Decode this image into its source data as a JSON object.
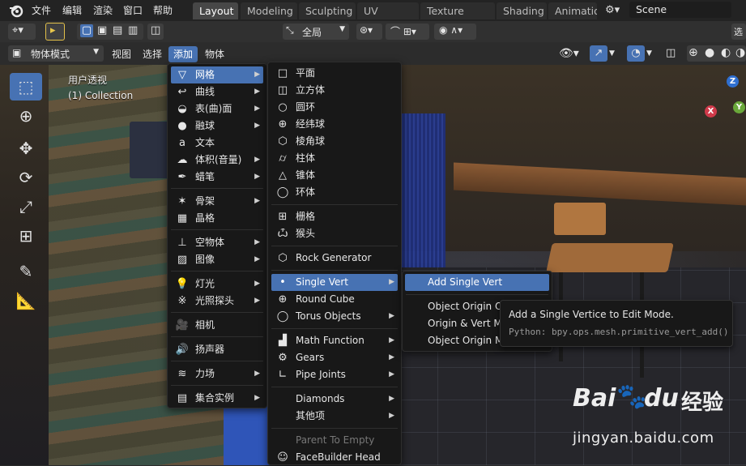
{
  "top_menu": {
    "items": [
      "文件",
      "编辑",
      "渲染",
      "窗口",
      "帮助"
    ]
  },
  "workspace_tabs": [
    "Layout",
    "Modeling",
    "Sculpting",
    "UV Editing",
    "Texture Paint",
    "Shading",
    "Animatio"
  ],
  "scene_name": "Scene",
  "tool_header": {
    "orientation": "全局"
  },
  "viewport_header": {
    "mode": "物体模式",
    "menus": [
      "视图",
      "选择",
      "添加",
      "物体"
    ]
  },
  "viewport_overlay": {
    "view_name": "用户透视",
    "collection": "(1) Collection"
  },
  "gizmo": {
    "z": "Z",
    "x": "X",
    "y": "Y"
  },
  "add_menu": {
    "items": [
      "网格",
      "曲线",
      "表(曲)面",
      "融球",
      "文本",
      "体积(音量)",
      "蜡笔",
      "骨架",
      "晶格",
      "空物体",
      "图像",
      "灯光",
      "光照探头",
      "相机",
      "扬声器",
      "力场",
      "集合实例"
    ]
  },
  "mesh_menu": {
    "items": [
      "平面",
      "立方体",
      "圆环",
      "经纬球",
      "棱角球",
      "柱体",
      "锥体",
      "环体",
      "栅格",
      "猴头",
      "Rock Generator",
      "Single Vert",
      "Round Cube",
      "Torus Objects",
      "Math Function",
      "Gears",
      "Pipe Joints",
      "Diamonds",
      "其他项",
      "Parent To Empty",
      "FaceBuilder Head"
    ]
  },
  "single_vert_menu": {
    "items": [
      "Add Single Vert",
      "Object Origin Or",
      "Origin & Vert Mir",
      "Object Origin Mi"
    ]
  },
  "tooltip": {
    "title": "Add a Single Vertice to Edit Mode.",
    "python": "Python: bpy.ops.mesh.primitive_vert_add()"
  },
  "watermark": {
    "brand": "Bai",
    "brand2": "du",
    "cn": "经验",
    "url": "jingyan.baidu.com"
  },
  "colors": {
    "accent": "#4772b3",
    "menu_bg": "#181818",
    "header_bg": "#232323"
  }
}
